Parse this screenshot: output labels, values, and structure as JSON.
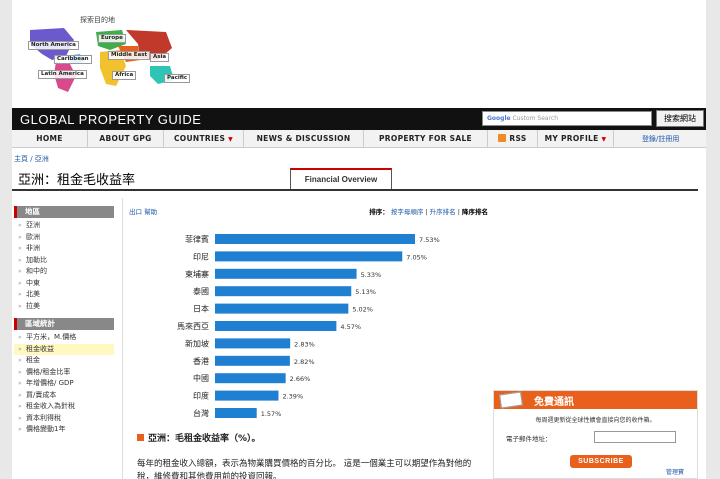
{
  "map": {
    "label": "探索目的地",
    "regions": [
      "North America",
      "Europe",
      "Caribbean",
      "Middle East",
      "Asia",
      "Latin America",
      "Africa",
      "Pacific"
    ]
  },
  "header": {
    "brand": "GLOBAL PROPERTY GUIDE",
    "search_google": "Google",
    "search_placeholder": "Custom Search",
    "search_button": "搜索網站"
  },
  "nav": {
    "items": [
      "HOME",
      "ABOUT GPG",
      "COUNTRIES",
      "NEWS & DISCUSSION",
      "PROPERTY FOR SALE",
      "RSS",
      "MY PROFILE"
    ],
    "login": "登錄/註冊用"
  },
  "breadcrumb": "主頁 / 亞洲",
  "page_title": "亞洲：租金毛收益率",
  "tab_label": "Financial Overview",
  "sidebar": {
    "section1_title": "地區",
    "regions": [
      "亞洲",
      "歐洲",
      "非洲",
      "加勒比",
      "和中的",
      "中東",
      "北美",
      "拉美"
    ],
    "section2_title": "區域統計",
    "stats": [
      "平方米，M.價格",
      "租金收益",
      "租金",
      "價格/租金比率",
      "年增價格/ GDP",
      "買/賣成本",
      "租金收入為針稅",
      "資本利得稅",
      "價格變動1年"
    ]
  },
  "main": {
    "export_link": "出口 幫助",
    "sort_label": "排序：",
    "sort_options": [
      "按字母順序",
      "升序排名",
      "降序排名"
    ],
    "sort_sep": " | ",
    "section_title": "亞洲：毛租金收益率（%）。",
    "body_text": "每年的租金收入總額，表示為物業購買價格的百分比。 這是一個業主可以期望作為對他的稅，維修費和其他費用前的投資回報。"
  },
  "chart_data": {
    "type": "bar",
    "orientation": "horizontal",
    "bar_color": "#1f7fd1",
    "categories": [
      "菲律賓",
      "印尼",
      "柬埔寨",
      "泰國",
      "日本",
      "馬來西亞",
      "新加坡",
      "香港",
      "中國",
      "印度",
      "台灣"
    ],
    "values": [
      7.53,
      7.05,
      5.33,
      5.13,
      5.02,
      4.57,
      2.83,
      2.82,
      2.66,
      2.39,
      1.57
    ],
    "value_labels": [
      "7.53%",
      "7.05%",
      "5.33%",
      "5.13%",
      "5.02%",
      "4.57%",
      "2.83%",
      "2.82%",
      "2.66%",
      "2.39%",
      "1.57%"
    ],
    "xlim": [
      0,
      8
    ]
  },
  "subscribe": {
    "title": "免費通訊",
    "desc": "每周週更新從全球性擴會直接向您的收件箱。",
    "email_label": "電子郵件地址：",
    "button": "SUBSCRIBE",
    "manage": "管理寶"
  },
  "colors": {
    "accent_orange": "#e8601c",
    "link_blue": "#1a56a8",
    "header_black": "#111111"
  }
}
